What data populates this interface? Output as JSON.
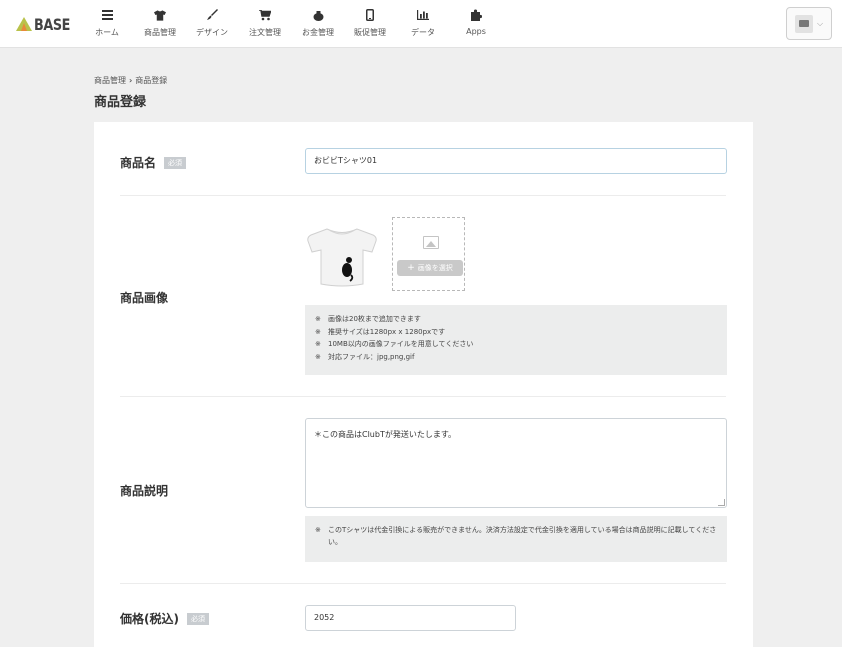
{
  "header": {
    "logo_text": "BASE",
    "nav": [
      {
        "label": "ホーム",
        "icon": "list-icon"
      },
      {
        "label": "商品管理",
        "icon": "shirt-icon"
      },
      {
        "label": "デザイン",
        "icon": "brush-icon"
      },
      {
        "label": "注文管理",
        "icon": "cart-icon"
      },
      {
        "label": "お金管理",
        "icon": "moneybag-icon"
      },
      {
        "label": "販促管理",
        "icon": "phone-icon"
      },
      {
        "label": "データ",
        "icon": "bar-chart-icon"
      },
      {
        "label": "Apps",
        "icon": "puzzle-icon"
      }
    ],
    "store_menu_icon": "store-icon"
  },
  "breadcrumb": {
    "parent": "商品管理",
    "separator": "›",
    "current": "商品登録"
  },
  "page_title": "商品登録",
  "form": {
    "required_badge": "必須",
    "name": {
      "label": "商品名",
      "value": "おビビTシャツ01"
    },
    "image": {
      "label": "商品画像",
      "select_button": "画像を選択",
      "notes": [
        "画像は20枚まで追加できます",
        "推奨サイズは1280px x 1280pxです",
        "10MB以内の画像ファイルを用意してください",
        "対応ファイル：jpg,png,gif"
      ]
    },
    "description": {
      "label": "商品説明",
      "value": "＊この商品はClubTが発送いたします。",
      "note": "このTシャツは代金引換による販売ができません。決済方法設定で代金引換を適用している場合は商品説明に記載してください。"
    },
    "price": {
      "label": "価格(税込)",
      "value": "2052"
    }
  },
  "note_mark": "※"
}
